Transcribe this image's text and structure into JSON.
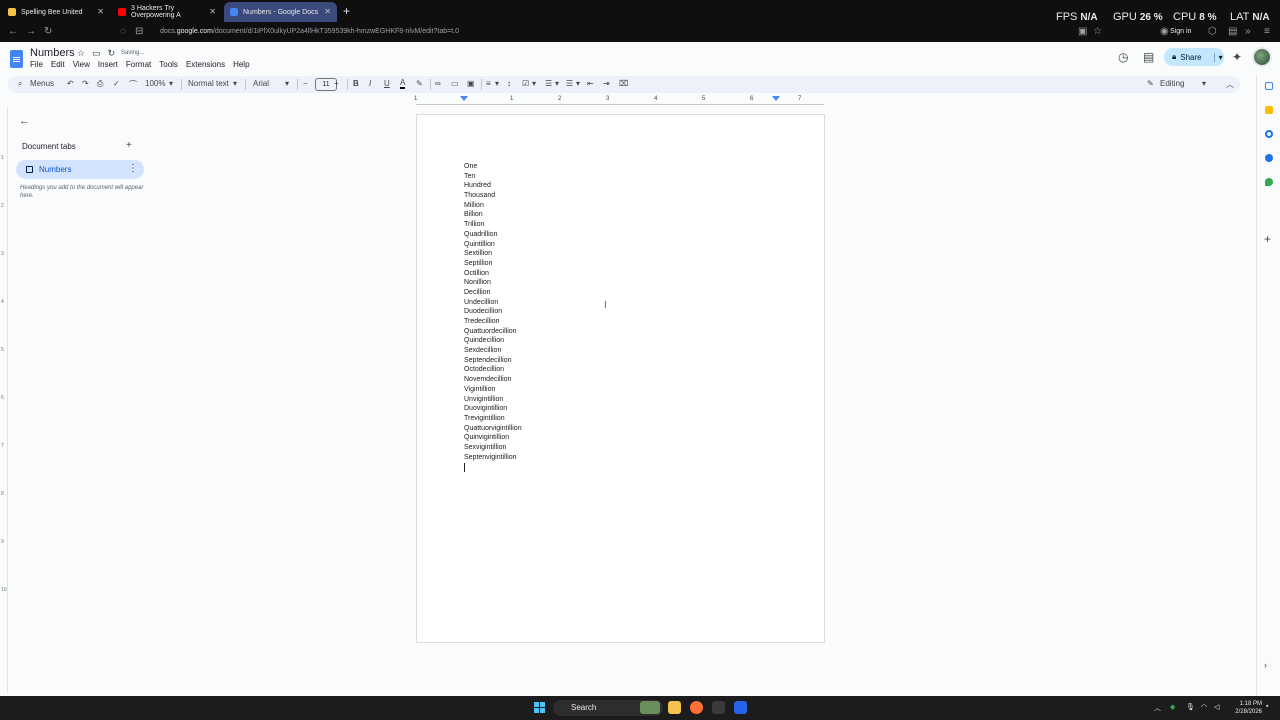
{
  "browser": {
    "tabs": [
      {
        "title": "Spelling Bee United",
        "active": false
      },
      {
        "title": "3 Hackers Try Overpowering A",
        "active": false
      },
      {
        "title": "Numbers - Google Docs",
        "active": true
      }
    ],
    "url_prefix": "docs.",
    "url_domain": "google.com",
    "url_path": "/document/d/1iPfX0ulkyUP2a4llHkT359539kh-hmzwEGHKF8-nlvM/edit?tab=t.0",
    "sign_in": "Sign in"
  },
  "perf_overlay": {
    "fps_label": "FPS",
    "fps_value": "N/A",
    "gpu_label": "GPU",
    "gpu_value": "26 %",
    "cpu_label": "CPU",
    "cpu_value": "8 %",
    "lat_label": "LAT",
    "lat_value": "N/A"
  },
  "docs": {
    "title": "Numbers",
    "saving_status": "Saving...",
    "menus": [
      "File",
      "Edit",
      "View",
      "Insert",
      "Format",
      "Tools",
      "Extensions",
      "Help"
    ],
    "share_label": "Share"
  },
  "toolbar": {
    "menus_label": "Menus",
    "zoom": "100%",
    "style": "Normal text",
    "font": "Arial",
    "font_size": "11",
    "mode": "Editing"
  },
  "ruler": {
    "numbers": [
      "1",
      "1",
      "2",
      "3",
      "4",
      "5",
      "6",
      "7"
    ]
  },
  "sidebar": {
    "heading": "Document tabs",
    "tab_label": "Numbers",
    "hint": "Headings you add to the document will appear here."
  },
  "document": {
    "lines": [
      "One",
      "Ten",
      "Hundred",
      "Thousand",
      "Million",
      "Billion",
      "Trillion",
      "Quadrillion",
      "Quintillion",
      "Sextillion",
      "Septillion",
      "Octillion",
      "Nonillion",
      "Decillion",
      "Undecillion",
      "Duodecillion",
      "Tredecillion",
      "Quattuordecillion",
      "Quindecillion",
      "Sexdecillion",
      "Septendecillion",
      "Octodecillion",
      "Novemdecillion",
      "Vigintillion",
      "Unvigintillion",
      "Duovigintillion",
      "Trevigintillion",
      "Quattuorvigintillion",
      "Quinvigintillion",
      "Sexvigintillion",
      "Septenvigintillion"
    ]
  },
  "taskbar": {
    "search_label": "Search",
    "time": "1:18 PM",
    "date": "2/28/2026"
  },
  "colors": {
    "docs_blue": "#4285f4",
    "share_bg": "#c2e7ff",
    "active_tab_bg": "#d3e3fd"
  }
}
